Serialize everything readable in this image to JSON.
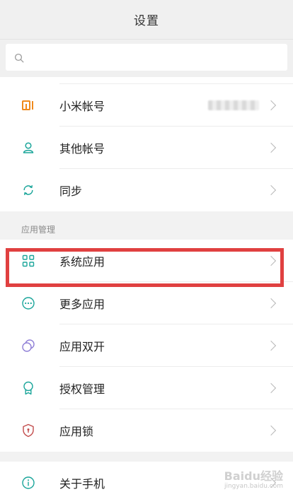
{
  "header": {
    "title": "设置"
  },
  "search": {
    "placeholder": ""
  },
  "groups": {
    "account": {
      "items": [
        {
          "label": "小米帐号",
          "value_blurred": true
        },
        {
          "label": "其他帐号"
        },
        {
          "label": "同步"
        }
      ]
    },
    "apps": {
      "section_title": "应用管理",
      "items": [
        {
          "label": "系统应用"
        },
        {
          "label": "更多应用"
        },
        {
          "label": "应用双开"
        },
        {
          "label": "授权管理"
        },
        {
          "label": "应用锁"
        }
      ]
    },
    "about": {
      "items": [
        {
          "label": "关于手机"
        }
      ]
    }
  },
  "watermark": {
    "main": "Baidu经验",
    "sub": "jingyan.baidu.com"
  },
  "colors": {
    "mi_orange": "#f08a1c",
    "teal": "#1aa59a",
    "purple": "#8f7fd6",
    "red_accent": "#e04040"
  },
  "icons": {
    "account": [
      "mi-logo-icon",
      "user-icon",
      "sync-icon"
    ],
    "apps": [
      "grid-icon",
      "more-dots-icon",
      "dual-app-icon",
      "badge-icon",
      "shield-icon"
    ],
    "about": [
      "info-icon"
    ]
  }
}
